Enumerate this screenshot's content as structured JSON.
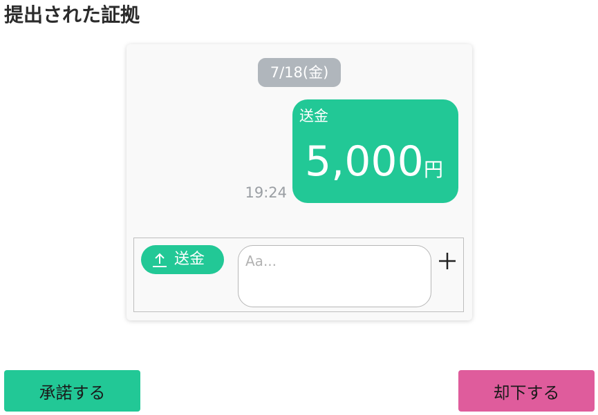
{
  "page": {
    "title": "提出された証拠"
  },
  "chat": {
    "date": "7/18(金)",
    "message": {
      "type_label": "送金",
      "amount": "5,000",
      "unit": "円",
      "time": "19:24"
    },
    "composer": {
      "send_label": "送金",
      "send_icon": "upload-arrow-icon",
      "input_placeholder": "Aa...",
      "input_value": "",
      "plus_icon": "plus-icon"
    }
  },
  "actions": {
    "approve_label": "承諾する",
    "reject_label": "却下する"
  },
  "colors": {
    "accent_green": "#22c896",
    "reject_pink": "#df5c9c",
    "date_chip_gray": "#b0b6bc",
    "card_bg": "#f9f9f9"
  }
}
